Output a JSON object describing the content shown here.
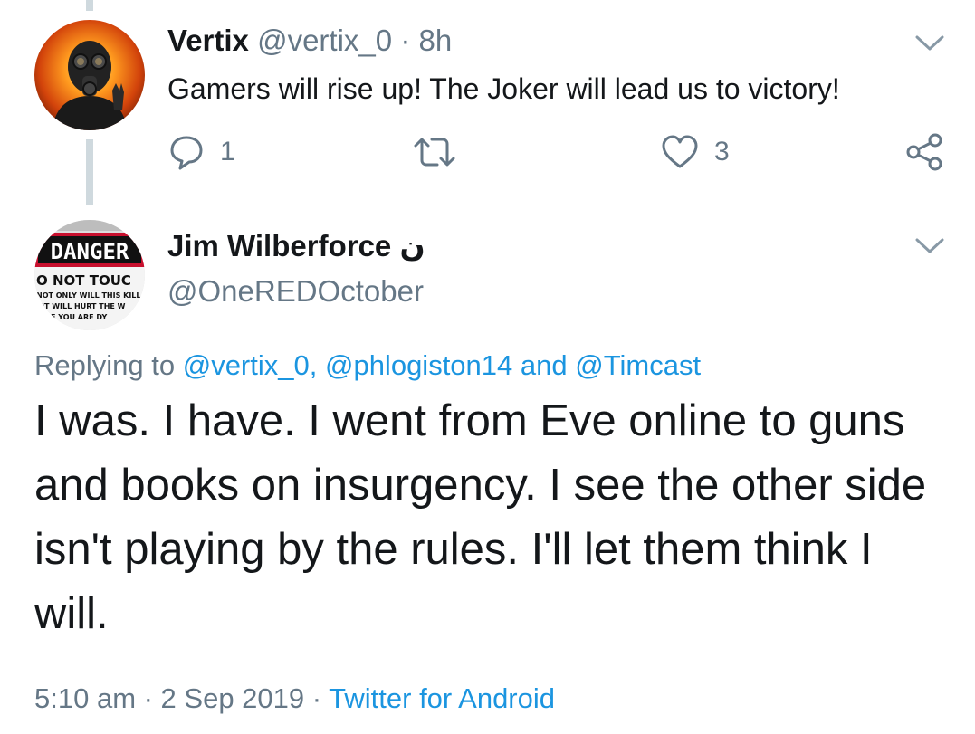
{
  "tweet1": {
    "display_name": "Vertix",
    "handle": "@vertix_0",
    "separator": "·",
    "time": "8h",
    "text": "Gamers will rise up! The Joker will lead us to victory!",
    "reply_count": "1",
    "like_count": "3"
  },
  "tweet2": {
    "display_name": "Jim Wilberforce",
    "name_glyph": "ن",
    "handle": "@OneREDOctober",
    "replying_prefix": "Replying to",
    "mentions": [
      "@vertix_0,",
      "@phlogiston14",
      "@Timcast"
    ],
    "mention_joiner": "and",
    "text": "I was. I have. I went from Eve online to guns and books on insurgency. I see the other side isn't playing by the rules. I'll let them think I will.",
    "timestamp": "5:10 am · 2 Sep 2019",
    "meta_separator": "·",
    "source": "Twitter for Android",
    "avatar_sign": {
      "line1": "DANGER",
      "line2": "O NOT TOUC",
      "line3": "NOT ONLY WILL THIS KILL",
      "line4": "IT WILL HURT THE W",
      "line5": "ME YOU ARE DY"
    }
  },
  "colors": {
    "text": "#14171a",
    "secondary": "#657786",
    "link": "#1b95e0",
    "thread_line": "#cfd9de",
    "danger_red": "#c8102e"
  },
  "icons": [
    "chevron-down-icon",
    "reply-icon",
    "retweet-icon",
    "like-icon",
    "share-icon"
  ]
}
